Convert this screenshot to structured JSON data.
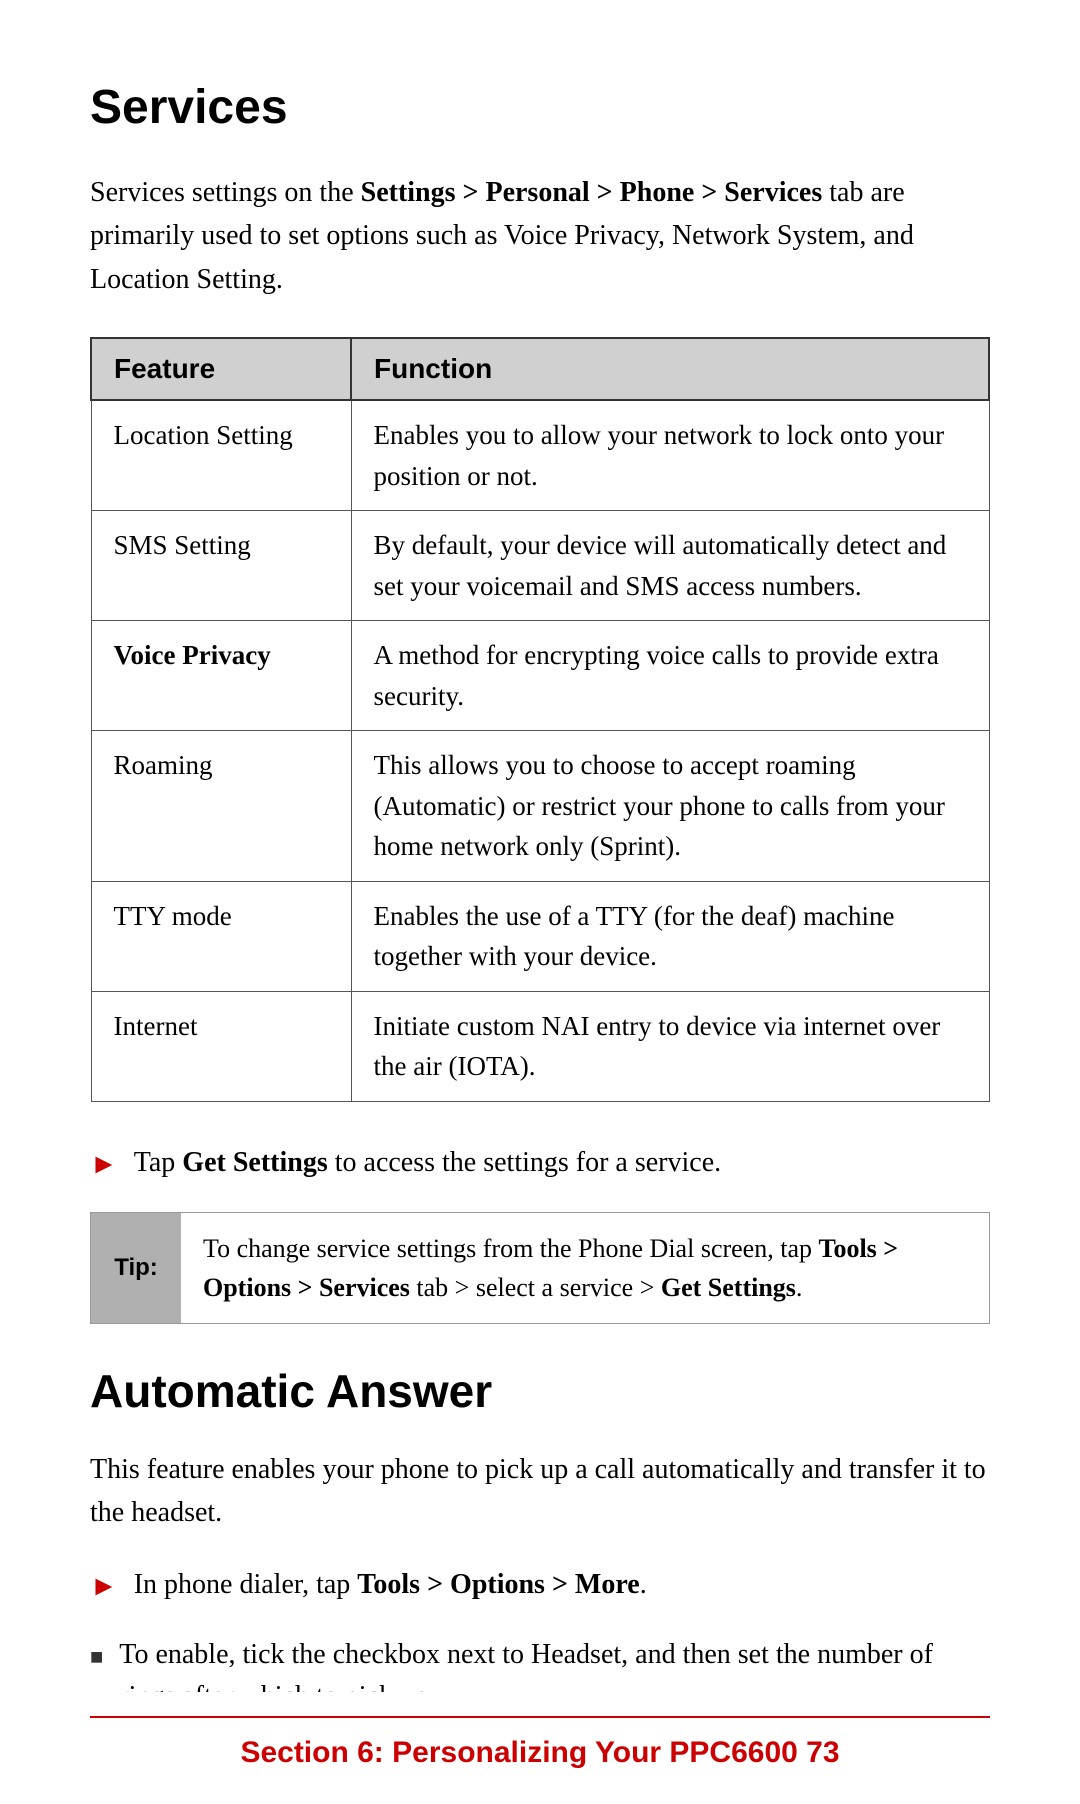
{
  "page": {
    "title": "Services",
    "intro": {
      "text_start": "Services settings on the ",
      "bold1": "Settings > Personal  > Phone > Services",
      "text_mid": " tab are primarily used to set options such as Voice Privacy, Network System, and Location Setting."
    },
    "table": {
      "col_feature": "Feature",
      "col_function": "Function",
      "rows": [
        {
          "feature": "Location Setting",
          "function": "Enables you to allow your network to lock onto your position or not.",
          "bold": false
        },
        {
          "feature": "SMS Setting",
          "function": "By default, your device will automatically detect and set your voicemail and SMS access numbers.",
          "bold": false
        },
        {
          "feature": "Voice Privacy",
          "function": "A method for encrypting voice calls to provide extra security.",
          "bold": true
        },
        {
          "feature": "Roaming",
          "function": "This allows you to choose to accept roaming (Automatic) or restrict your phone to calls from your home network only (Sprint).",
          "bold": false
        },
        {
          "feature": "TTY mode",
          "function": "Enables the use of a TTY (for the deaf) machine together with your device.",
          "bold": false
        },
        {
          "feature": "Internet",
          "function": "Initiate custom NAI entry to device via internet over the air (IOTA).",
          "bold": false
        }
      ]
    },
    "bullet1": {
      "text_start": "Tap ",
      "bold": "Get Settings",
      "text_end": " to access the settings for a service."
    },
    "tip": {
      "label": "Tip:",
      "text_start": "To change service settings from the Phone Dial screen, tap ",
      "bold1": "Tools >",
      "text_mid": " ",
      "bold2": "Options > Services",
      "text_mid2": " tab > select a service > ",
      "bold3": "Get Settings",
      "text_end": "."
    },
    "section2_title": "Automatic Answer",
    "section2_body": "This feature enables your phone to pick up a call automatically and transfer it to the headset.",
    "bullet2": {
      "text_start": "In phone dialer, tap ",
      "bold1": "Tools > Options > More",
      "text_end": "."
    },
    "bullet3": {
      "text_start": "To enable, tick the checkbox next to Headset, and then set the number of rings after which to pick up."
    },
    "footer": {
      "text": "Section 6: Personalizing Your PPC6600   73"
    }
  }
}
